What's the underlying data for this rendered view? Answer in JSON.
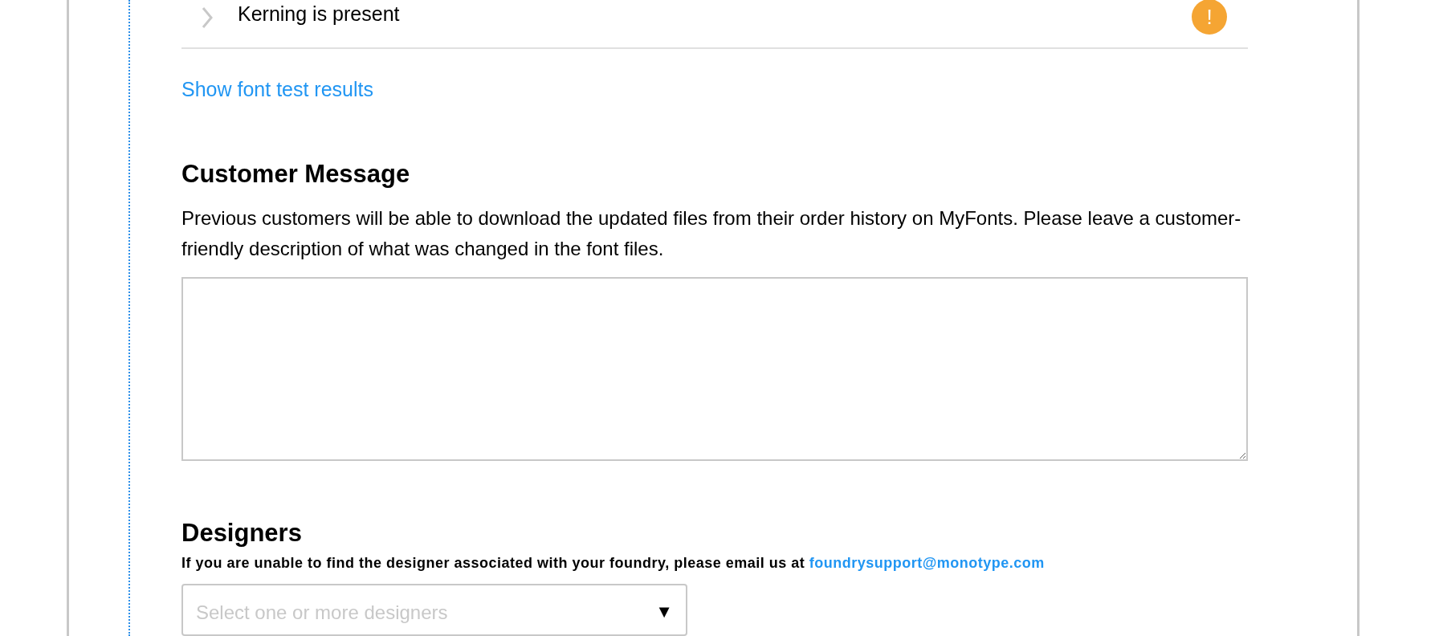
{
  "checks": [
    {
      "label": "Kerning is present",
      "expanded": false,
      "color": "#f5a533",
      "icon": "!"
    }
  ],
  "results_link": "Show font test results",
  "customer_message": {
    "heading": "Customer Message",
    "description": "Previous customers will be able to download the updated files from their order history on MyFonts. Please leave a customer-friendly description of what was changed in the font files."
  },
  "designers": {
    "heading": "Designers",
    "note": "If you are unable to find the designer associated with your foundry, please email us at ",
    "email": "foundrysupport@monotype.com",
    "placeholder": "Select one or more designers",
    "caret": "▼"
  }
}
